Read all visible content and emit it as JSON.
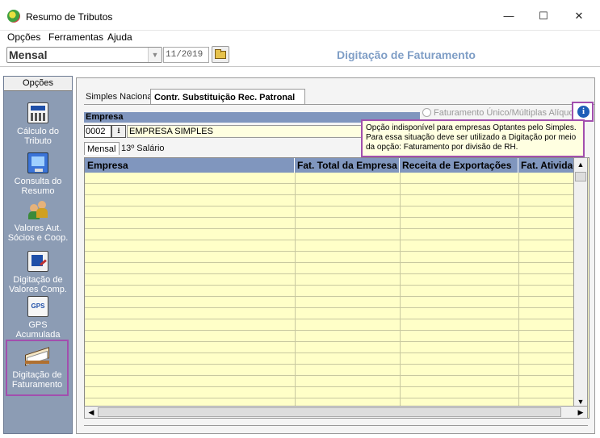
{
  "window": {
    "title": "Resumo de Tributos",
    "minimize": "—",
    "maximize": "☐",
    "close": "✕"
  },
  "menu": {
    "items": [
      {
        "label": "Opções"
      },
      {
        "label": "Ferramentas"
      },
      {
        "label": "Ajuda"
      }
    ]
  },
  "toolbar": {
    "period_type": "Mensal",
    "period_value": "11/2019",
    "page_title": "Digitação de Faturamento"
  },
  "sidebar": {
    "header": "Opções",
    "items": [
      {
        "label_1": "Cálculo do",
        "label_2": "Tributo",
        "icon": "calculator-icon"
      },
      {
        "label_1": "Consulta do",
        "label_2": "Resumo",
        "icon": "monitor-icon"
      },
      {
        "label_1": "Valores Aut.",
        "label_2": "Sócios e Coop.",
        "icon": "users-icon"
      },
      {
        "label_1": "Digitação de",
        "label_2": "Valores Comp.",
        "icon": "document-edit-icon"
      },
      {
        "label_1": "GPS",
        "label_2": "Acumulada",
        "icon": "gps-icon"
      },
      {
        "label_1": "Digitação de",
        "label_2": "Faturamento",
        "icon": "open-book-icon"
      }
    ]
  },
  "tabs": {
    "simples": "Simples Nacional",
    "contr": "Contr. Substituição Rec. Patronal"
  },
  "empresa": {
    "header": "Empresa",
    "code": "0002",
    "name": "EMPRESA SIMPLES",
    "radio_label": "Faturamento Único/Múltiplas Alíquotas",
    "lookup": "⭳"
  },
  "tooltip": {
    "line_1": "Opção indisponível para empresas Optantes pelo Simples.",
    "line_2": "Para essa situação deve ser utilizado a Digitação por meio",
    "line_3": "da opção: Faturamento por divisão de RH."
  },
  "subtabs": {
    "mensal": "Mensal",
    "decimo": "13º Salário"
  },
  "grid": {
    "columns": [
      "Empresa",
      "Fat. Total da Empresa",
      "Receita de Exportações",
      "Fat. Atividades"
    ]
  },
  "colors": {
    "sidebar_bg": "#8c9cb4",
    "header_blue": "#8096be",
    "grid_yellow": "#ffffc8",
    "highlight": "#a24fae",
    "title_blue": "#7f9ec6"
  }
}
